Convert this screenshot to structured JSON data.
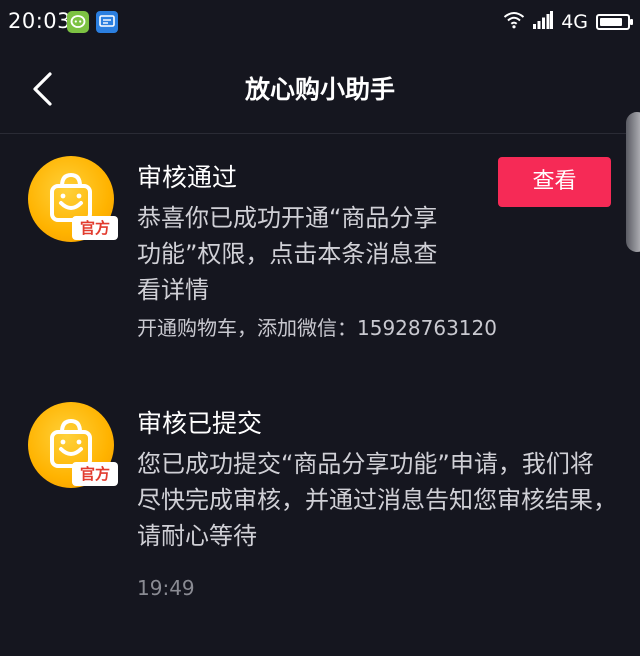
{
  "status_bar": {
    "time": "20:03",
    "network": "4G",
    "battery_level": 0.85
  },
  "nav": {
    "title": "放心购小助手"
  },
  "messages": [
    {
      "title": "审核通过",
      "body": "恭喜你已成功开通“商品分享功能”权限，点击本条消息查看详情",
      "contact": "开通购物车，添加微信：15928763120",
      "badge": "官方",
      "button_label": "查看"
    },
    {
      "title": "审核已提交",
      "body": "您已成功提交“商品分享功能”申请，我们将尽快完成审核，并通过消息告知您审核结果，请耐心等待",
      "badge": "官方"
    }
  ],
  "timestamp": "19:49",
  "colors": {
    "background": "#15161f",
    "accent": "#f62a56",
    "avatar": "#ffb300"
  }
}
